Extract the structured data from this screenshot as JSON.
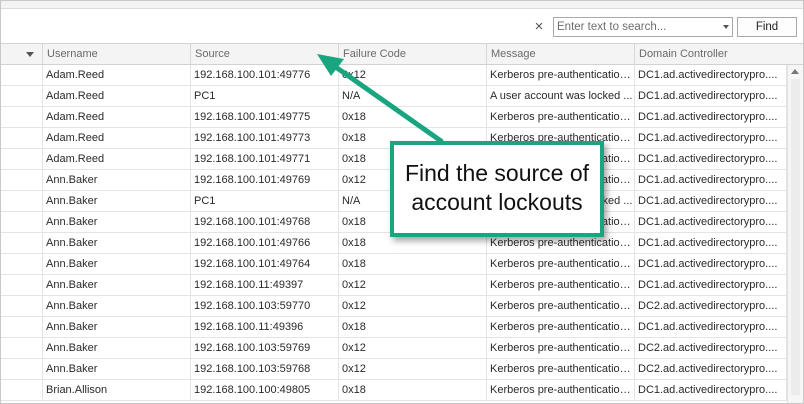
{
  "search": {
    "clear_symbol": "×",
    "placeholder": "Enter text to search...",
    "value": "",
    "find_label": "Find"
  },
  "columns": {
    "username": "Username",
    "source": "Source",
    "failure_code": "Failure Code",
    "message": "Message",
    "domain_controller": "Domain Controller"
  },
  "rows": [
    {
      "username": "Adam.Reed",
      "source": "192.168.100.101:49776",
      "code": "0x12",
      "message": "Kerberos pre-authentication...",
      "dc": "DC1.ad.activedirectorypro...."
    },
    {
      "username": "Adam.Reed",
      "source": "PC1",
      "code": "N/A",
      "message": "A user account was locked ...",
      "dc": "DC1.ad.activedirectorypro...."
    },
    {
      "username": "Adam.Reed",
      "source": "192.168.100.101:49775",
      "code": "0x18",
      "message": "Kerberos pre-authentication...",
      "dc": "DC1.ad.activedirectorypro...."
    },
    {
      "username": "Adam.Reed",
      "source": "192.168.100.101:49773",
      "code": "0x18",
      "message": "Kerberos pre-authentication...",
      "dc": "DC1.ad.activedirectorypro...."
    },
    {
      "username": "Adam.Reed",
      "source": "192.168.100.101:49771",
      "code": "0x18",
      "message": "Kerberos pre-authentication...",
      "dc": "DC1.ad.activedirectorypro...."
    },
    {
      "username": "Ann.Baker",
      "source": "192.168.100.101:49769",
      "code": "0x12",
      "message": "Kerberos pre-authentication...",
      "dc": "DC1.ad.activedirectorypro...."
    },
    {
      "username": "Ann.Baker",
      "source": "PC1",
      "code": "N/A",
      "message": "A user account was locked ...",
      "dc": "DC1.ad.activedirectorypro...."
    },
    {
      "username": "Ann.Baker",
      "source": "192.168.100.101:49768",
      "code": "0x18",
      "message": "Kerberos pre-authentication...",
      "dc": "DC1.ad.activedirectorypro...."
    },
    {
      "username": "Ann.Baker",
      "source": "192.168.100.101:49766",
      "code": "0x18",
      "message": "Kerberos pre-authentication...",
      "dc": "DC1.ad.activedirectorypro...."
    },
    {
      "username": "Ann.Baker",
      "source": "192.168.100.101:49764",
      "code": "0x18",
      "message": "Kerberos pre-authentication...",
      "dc": "DC1.ad.activedirectorypro...."
    },
    {
      "username": "Ann.Baker",
      "source": "192.168.100.11:49397",
      "code": "0x12",
      "message": "Kerberos pre-authentication...",
      "dc": "DC1.ad.activedirectorypro...."
    },
    {
      "username": "Ann.Baker",
      "source": "192.168.100.103:59770",
      "code": "0x12",
      "message": "Kerberos pre-authentication...",
      "dc": "DC2.ad.activedirectorypro...."
    },
    {
      "username": "Ann.Baker",
      "source": "192.168.100.11:49396",
      "code": "0x18",
      "message": "Kerberos pre-authentication...",
      "dc": "DC1.ad.activedirectorypro...."
    },
    {
      "username": "Ann.Baker",
      "source": "192.168.100.103:59769",
      "code": "0x12",
      "message": "Kerberos pre-authentication...",
      "dc": "DC2.ad.activedirectorypro...."
    },
    {
      "username": "Ann.Baker",
      "source": "192.168.100.103:59768",
      "code": "0x12",
      "message": "Kerberos pre-authentication...",
      "dc": "DC2.ad.activedirectorypro...."
    },
    {
      "username": "Brian.Allison",
      "source": "192.168.100.100:49805",
      "code": "0x18",
      "message": "Kerberos pre-authentication...",
      "dc": "DC1.ad.activedirectorypro...."
    }
  ],
  "callout": {
    "line1": "Find the source of",
    "line2": "account lockouts"
  },
  "colors": {
    "callout_border": "#18a57f",
    "arrow": "#18a57f"
  }
}
